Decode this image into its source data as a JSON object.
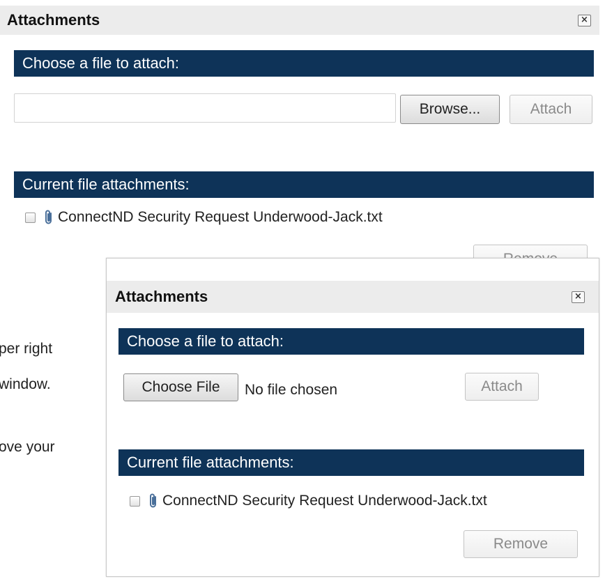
{
  "dialog1": {
    "title": "Attachments",
    "close_glyph": "×",
    "section_choose": "Choose a file to attach:",
    "file_input_value": "",
    "browse_label": "Browse...",
    "attach_label": "Attach",
    "section_current": "Current file attachments:",
    "attachments": [
      {
        "name": "ConnectND Security Request Underwood-Jack.txt",
        "checked": false
      }
    ],
    "remove_label": "Remove"
  },
  "dialog2": {
    "title": "Attachments",
    "close_glyph": "×",
    "section_choose": "Choose a file to attach:",
    "choose_file_label": "Choose File",
    "no_file_text": "No file chosen",
    "attach_label": "Attach",
    "section_current": "Current file attachments:",
    "attachments": [
      {
        "name": "ConnectND Security Request Underwood-Jack.txt",
        "checked": false
      }
    ],
    "remove_label": "Remove"
  },
  "background_text": {
    "line1": "per right",
    "line2": "window.",
    "line3": "ove your"
  },
  "colors": {
    "section_bar": "#0e3358",
    "titlebar": "#ececec"
  },
  "icons": {
    "close": "close-icon",
    "attachment": "paperclip-icon"
  }
}
